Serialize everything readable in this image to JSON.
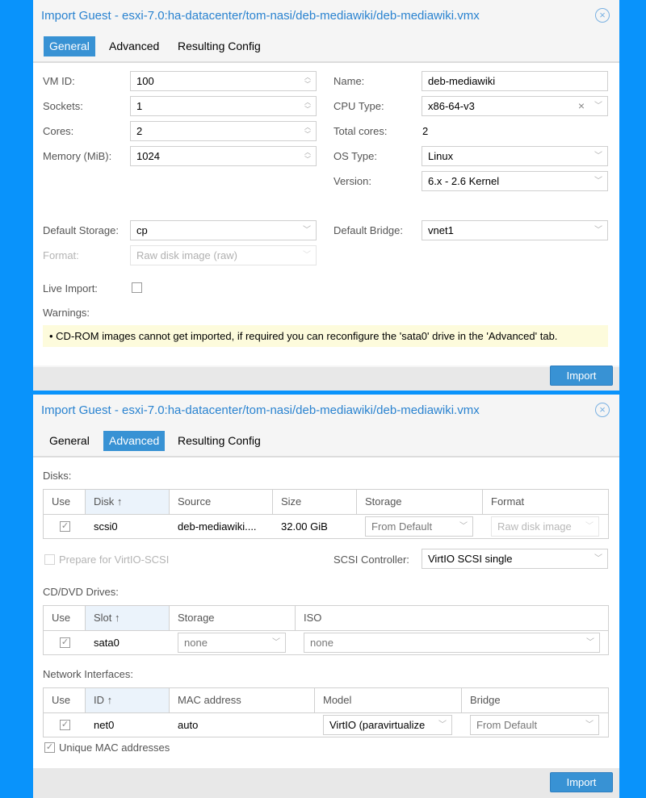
{
  "dialogs": [
    {
      "title": "Import Guest - esxi-7.0:ha-datacenter/tom-nasi/deb-mediawiki/deb-mediawiki.vmx",
      "tabs": [
        {
          "label": "General",
          "active": true
        },
        {
          "label": "Advanced",
          "active": false
        },
        {
          "label": "Resulting Config",
          "active": false
        }
      ],
      "general": {
        "vm_id": {
          "label": "VM ID:",
          "value": "100"
        },
        "sockets": {
          "label": "Sockets:",
          "value": "1"
        },
        "cores": {
          "label": "Cores:",
          "value": "2"
        },
        "memory": {
          "label": "Memory (MiB):",
          "value": "1024"
        },
        "name": {
          "label": "Name:",
          "value": "deb-mediawiki"
        },
        "cpu_type": {
          "label": "CPU Type:",
          "value": "x86-64-v3"
        },
        "total_cores": {
          "label": "Total cores:",
          "value": "2"
        },
        "os_type": {
          "label": "OS Type:",
          "value": "Linux"
        },
        "version": {
          "label": "Version:",
          "value": "6.x - 2.6 Kernel"
        },
        "default_storage": {
          "label": "Default Storage:",
          "value": "cp"
        },
        "format": {
          "label": "Format:",
          "value": "Raw disk image (raw)"
        },
        "default_bridge": {
          "label": "Default Bridge:",
          "value": "vnet1"
        },
        "live_import": {
          "label": "Live Import:",
          "checked": false
        },
        "warnings_label": "Warnings:",
        "warning": "• CD-ROM images cannot get imported, if required you can reconfigure the 'sata0' drive in the 'Advanced' tab."
      },
      "import_label": "Import"
    },
    {
      "title": "Import Guest - esxi-7.0:ha-datacenter/tom-nasi/deb-mediawiki/deb-mediawiki.vmx",
      "tabs": [
        {
          "label": "General",
          "active": false
        },
        {
          "label": "Advanced",
          "active": true
        },
        {
          "label": "Resulting Config",
          "active": false
        }
      ],
      "advanced": {
        "disks_label": "Disks:",
        "disks_columns": [
          "Use",
          "Disk ↑",
          "Source",
          "Size",
          "Storage",
          "Format"
        ],
        "disks_rows": [
          {
            "use": true,
            "disk": "scsi0",
            "source": "deb-mediawiki....",
            "size": "32.00 GiB",
            "storage": "From Default",
            "format": "Raw disk image"
          }
        ],
        "prepare_virtio": {
          "label": "Prepare for VirtIO-SCSI",
          "checked": false
        },
        "scsi_controller": {
          "label": "SCSI Controller:",
          "value": "VirtIO SCSI single"
        },
        "cd_label": "CD/DVD Drives:",
        "cd_columns": [
          "Use",
          "Slot ↑",
          "Storage",
          "ISO"
        ],
        "cd_rows": [
          {
            "use": true,
            "slot": "sata0",
            "storage": "none",
            "iso": "none"
          }
        ],
        "net_label": "Network Interfaces:",
        "net_columns": [
          "Use",
          "ID ↑",
          "MAC address",
          "Model",
          "Bridge"
        ],
        "net_rows": [
          {
            "use": true,
            "id": "net0",
            "mac": "auto",
            "model": "VirtIO (paravirtualize",
            "bridge": "From Default"
          }
        ],
        "unique_mac": {
          "label": "Unique MAC addresses",
          "checked": true
        }
      },
      "import_label": "Import"
    }
  ],
  "icons": {
    "close": "⊗",
    "chevron": "﹀",
    "spinner_up": "︿",
    "spinner_down": "﹀",
    "clear": "×",
    "check": "✓"
  }
}
